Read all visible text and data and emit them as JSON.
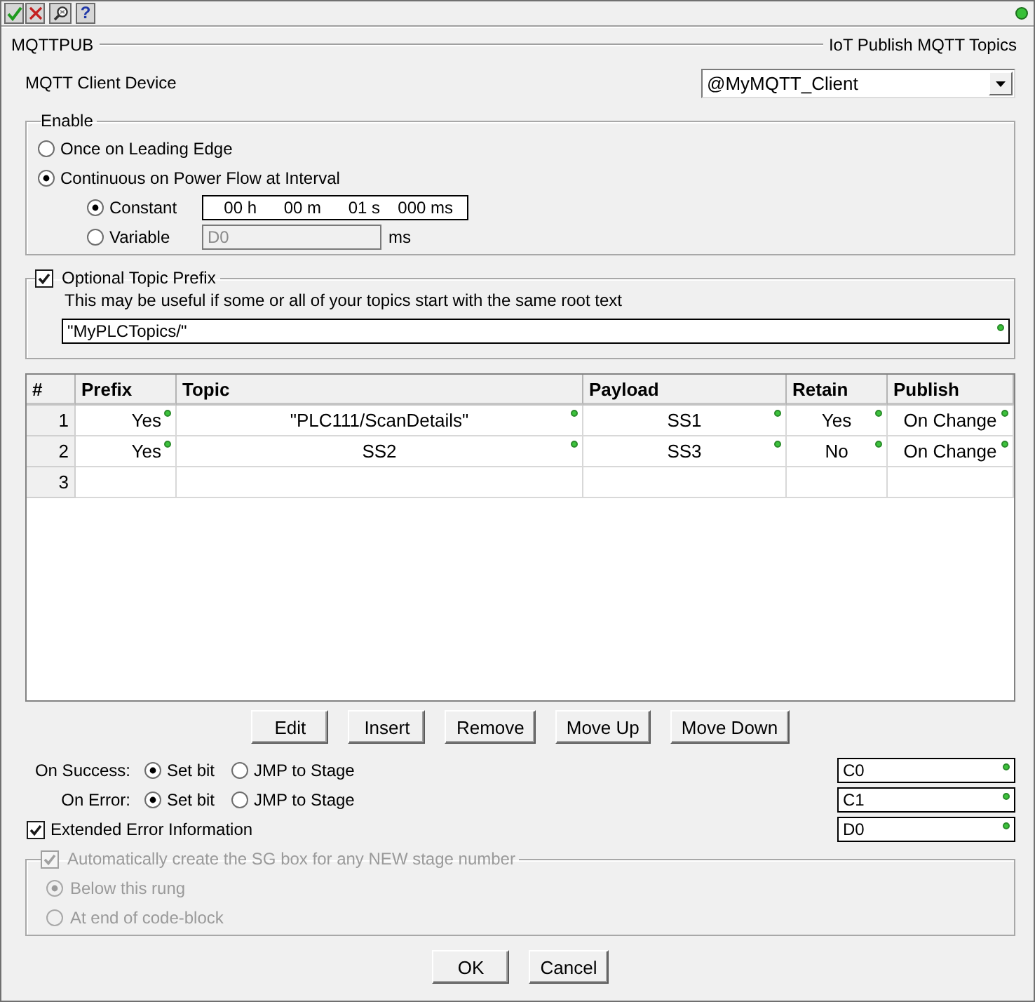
{
  "toolbar": [
    {
      "kind": "accept"
    },
    {
      "kind": "cancel"
    },
    {
      "kind": "find"
    },
    {
      "kind": "help",
      "label": "?"
    }
  ],
  "title_bar": {
    "instruction": "MQTTPUB",
    "description": "IoT Publish MQTT Topics"
  },
  "client_device": {
    "label": "MQTT Client Device",
    "value": "@MyMQTT_Client"
  },
  "enable": {
    "legend": "Enable",
    "modes": [
      {
        "label": "Once on Leading Edge",
        "selected": false
      },
      {
        "label": "Continuous on Power Flow at Interval",
        "selected": true
      }
    ],
    "interval_sources": [
      {
        "kind": "constant",
        "label": "Constant",
        "selected": true,
        "parts": [
          "00 h",
          "00 m",
          "01 s",
          "000 ms"
        ]
      },
      {
        "kind": "variable",
        "label": "Variable",
        "selected": false,
        "value": "D0",
        "unit": "ms"
      }
    ]
  },
  "topic_prefix": {
    "label": "Optional Topic Prefix",
    "checked": true,
    "hint": "This may be useful if some or all of your topics start with the same root text",
    "value": "\"MyPLCTopics/\""
  },
  "table": {
    "columns": [
      "#",
      "Prefix",
      "Topic",
      "Payload",
      "Retain",
      "Publish"
    ],
    "rows": [
      {
        "number": "1",
        "cells": [
          "Yes",
          "\"PLC111/ScanDetails\"",
          "SS1",
          "Yes",
          "On Change"
        ]
      },
      {
        "number": "2",
        "cells": [
          "Yes",
          "SS2",
          "SS3",
          "No",
          "On Change"
        ]
      },
      {
        "number": "3"
      }
    ]
  },
  "row_buttons": [
    "Edit",
    "Insert",
    "Remove",
    "Move Up",
    "Move Down"
  ],
  "outcomes": [
    {
      "label": "On Success:",
      "options": [
        {
          "label": "Set bit",
          "selected": true
        },
        {
          "label": "JMP to Stage",
          "selected": false
        }
      ],
      "value": "C0"
    },
    {
      "label": "On Error:",
      "options": [
        {
          "label": "Set bit",
          "selected": true
        },
        {
          "label": "JMP to Stage",
          "selected": false
        }
      ],
      "value": "C1"
    }
  ],
  "extended_error": {
    "label": "Extended Error Information",
    "checked": true,
    "value": "D0"
  },
  "stage_box": {
    "label": "Automatically create the SG box for any NEW stage number",
    "checked": true,
    "disabled": true,
    "options": [
      {
        "label": "Below this rung",
        "selected": true
      },
      {
        "label": "At end of code-block",
        "selected": false
      }
    ]
  },
  "dialog_buttons": [
    "OK",
    "Cancel"
  ]
}
